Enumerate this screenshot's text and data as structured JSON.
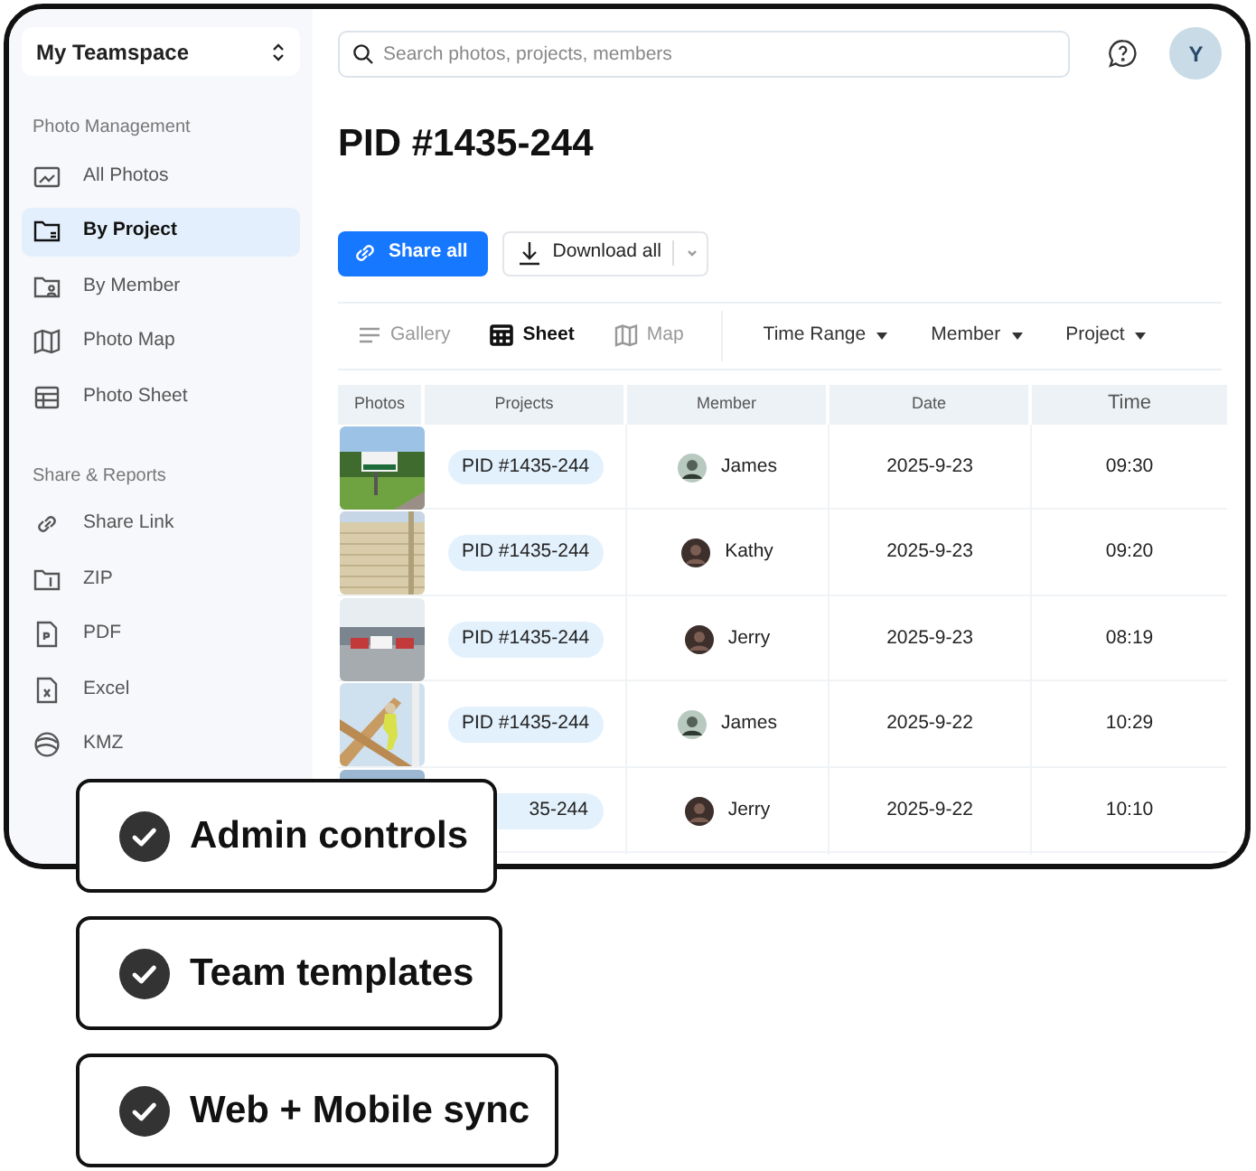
{
  "workspace": {
    "name": "My Teamspace"
  },
  "sidebar": {
    "sections": [
      {
        "title": "Photo Management",
        "items": [
          {
            "label": "All Photos",
            "selected": false
          },
          {
            "label": "By Project",
            "selected": true
          },
          {
            "label": "By Member",
            "selected": false
          },
          {
            "label": "Photo Map",
            "selected": false
          },
          {
            "label": "Photo Sheet",
            "selected": false
          }
        ]
      },
      {
        "title": "Share & Reports",
        "items": [
          {
            "label": "Share Link",
            "selected": false
          },
          {
            "label": "ZIP",
            "selected": false
          },
          {
            "label": "PDF",
            "selected": false
          },
          {
            "label": "Excel",
            "selected": false
          },
          {
            "label": "KMZ",
            "selected": false
          }
        ]
      }
    ]
  },
  "search": {
    "placeholder": "Search photos, projects, members"
  },
  "user": {
    "initial": "Y"
  },
  "title": "PID #1435-244",
  "actions": {
    "share": "Share all",
    "download": "Download all"
  },
  "views": [
    {
      "label": "Gallery",
      "selected": false
    },
    {
      "label": "Sheet",
      "selected": true
    },
    {
      "label": "Map",
      "selected": false
    }
  ],
  "filters": [
    "Time Range",
    "Member",
    "Project"
  ],
  "table": {
    "columns": [
      "Photos",
      "Projects",
      "Member",
      "Date",
      "Time"
    ],
    "rows": [
      {
        "project": "PID #1435-244",
        "member": "James",
        "date": "2025-9-23",
        "time": "09:30"
      },
      {
        "project": "PID #1435-244",
        "member": "Kathy",
        "date": "2025-9-23",
        "time": "09:20"
      },
      {
        "project": "PID #1435-244",
        "member": "Jerry",
        "date": "2025-9-23",
        "time": "08:19"
      },
      {
        "project": "PID #1435-244",
        "member": "James",
        "date": "2025-9-22",
        "time": "10:29"
      },
      {
        "project": "35-244",
        "member": "Jerry",
        "date": "2025-9-22",
        "time": "10:10"
      }
    ]
  },
  "features": [
    "Admin controls",
    "Team templates",
    "Web + Mobile sync"
  ]
}
